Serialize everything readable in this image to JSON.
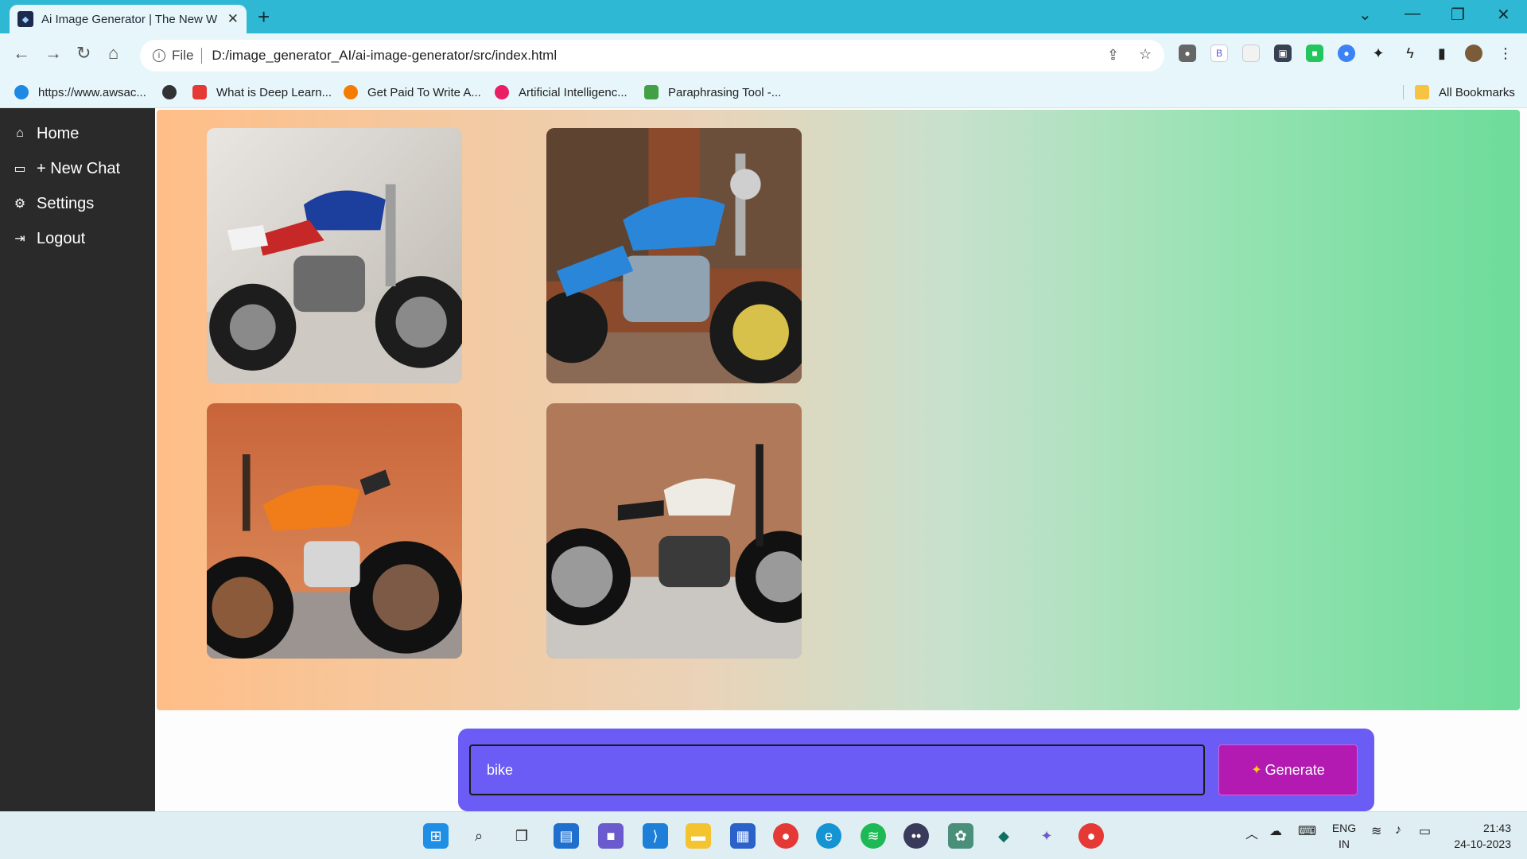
{
  "browser": {
    "tab_title": "Ai Image Generator | The New W",
    "address_scheme": "File",
    "address_url": "D:/image_generator_AI/ai-image-generator/src/index.html",
    "bookmarks": [
      {
        "label": "https://www.awsac...",
        "color": "#1e88e5"
      },
      {
        "label": "",
        "color": "#333333"
      },
      {
        "label": "What is Deep Learn...",
        "color": "#e53935"
      },
      {
        "label": "Get Paid To Write A...",
        "color": "#f57c00"
      },
      {
        "label": "Artificial Intelligenc...",
        "color": "#e91e63"
      },
      {
        "label": "Paraphrasing Tool -...",
        "color": "#43a047"
      }
    ],
    "all_bookmarks": "All Bookmarks"
  },
  "sidebar": {
    "items": [
      {
        "label": "Home",
        "icon": "home-icon"
      },
      {
        "label": "+ New Chat",
        "icon": "chat-icon"
      },
      {
        "label": "Settings",
        "icon": "gear-icon"
      },
      {
        "label": "Logout",
        "icon": "logout-icon"
      }
    ]
  },
  "gallery": {
    "images": [
      {
        "name": "generated-image-1",
        "description": "blue and red cafe racer motorcycle"
      },
      {
        "name": "generated-image-2",
        "description": "blue cruiser motorcycle"
      },
      {
        "name": "generated-image-3",
        "description": "orange motorized bicycle"
      },
      {
        "name": "generated-image-4",
        "description": "white and black motorcycle"
      }
    ]
  },
  "prompt": {
    "value": "bike",
    "generate_label": "Generate"
  },
  "taskbar": {
    "lang_top": "ENG",
    "lang_bottom": "IN",
    "time": "21:43",
    "date": "24-10-2023"
  },
  "colors": {
    "sidebar_bg": "#2a2a2a",
    "prompt_bg": "#6a5cf5",
    "button_bg": "#b31ab2",
    "gradient_start": "#ffbe87",
    "gradient_end": "#6ddc9a"
  }
}
